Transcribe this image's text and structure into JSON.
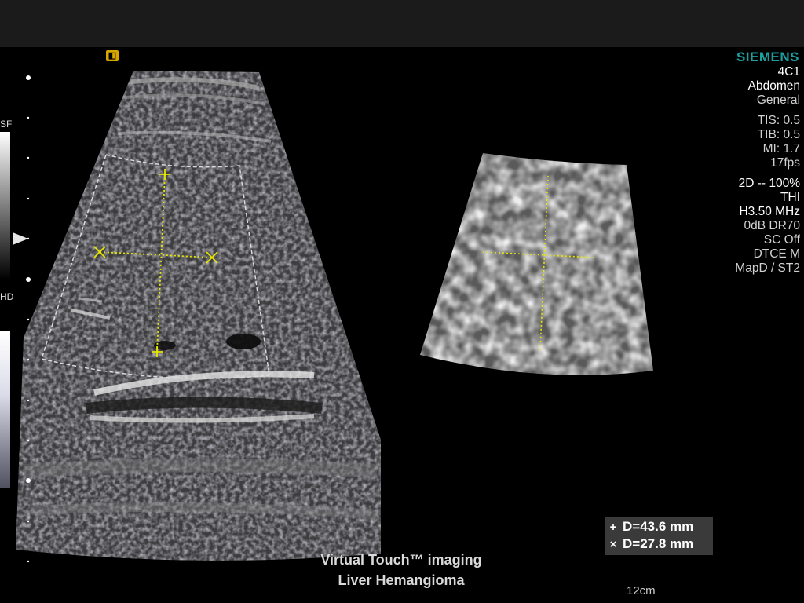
{
  "header": {
    "brand": "SIEMENS"
  },
  "params": {
    "transducer": "4C1",
    "exam": "Abdomen",
    "preset": "General",
    "tis": "TIS: 0.5",
    "tib": "TIB: 0.5",
    "mi": "MI: 1.7",
    "fps": "17fps",
    "mode": "2D -- 100%",
    "thi": "THI",
    "freq": "H3.50 MHz",
    "gain_dr": "0dB DR70",
    "sc": "SC Off",
    "dtce": "DTCE M",
    "map": "MapD / ST2"
  },
  "scale": {
    "top_label": "SF",
    "bottom_label": "HD",
    "depth": "12cm"
  },
  "orientation_icon": "orientation-marker-icon",
  "measurements": [
    {
      "symbol": "plus-caliper-icon",
      "glyph": "+",
      "label": "D=43.6 mm"
    },
    {
      "symbol": "x-caliper-icon",
      "glyph": "×",
      "label": "D=27.8 mm"
    }
  ],
  "caption": {
    "line1": "Virtual Touch™ imaging",
    "line2": "Liver Hemangioma"
  },
  "colors": {
    "brand": "#1e9e9e",
    "caliper": "#e6e600",
    "background": "#000000"
  }
}
